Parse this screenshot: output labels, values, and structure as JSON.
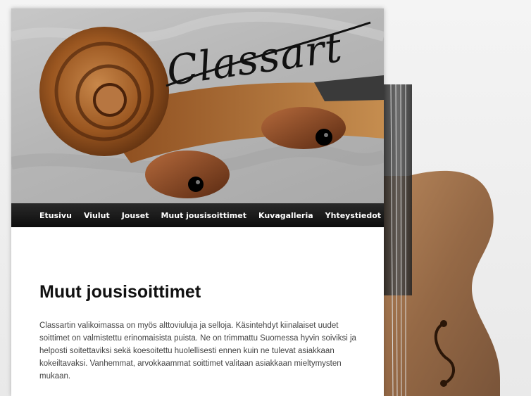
{
  "site": {
    "logo_text": "Classart"
  },
  "nav": {
    "items": [
      {
        "label": "Etusivu"
      },
      {
        "label": "Viulut"
      },
      {
        "label": "Jouset"
      },
      {
        "label": "Muut jousisoittimet"
      },
      {
        "label": "Kuvagalleria"
      },
      {
        "label": "Yhteystiedot"
      }
    ]
  },
  "content": {
    "title": "Muut jousisoittimet",
    "paragraph": "Classartin valikoimassa on myös alttoviuluja ja selloja. Käsintehdyt kiinalaiset uudet soittimet on valmistettu erinomaisista puista. Ne on trimmattu Suomessa hyvin soiviksi ja helposti soitettaviksi sekä koesoitettu huolellisesti ennen kuin ne tulevat asiakkaan kokeiltavaksi. Vanhemmat, arvokkaammat soittimet valitaan asiakkaan mieltymysten mukaan."
  },
  "colors": {
    "nav_bg": "#111111",
    "nav_text": "#ffffff",
    "wood": "#8a4a1c"
  },
  "icons": {
    "header": "violin-scroll-image",
    "background": "violin-body-image"
  }
}
